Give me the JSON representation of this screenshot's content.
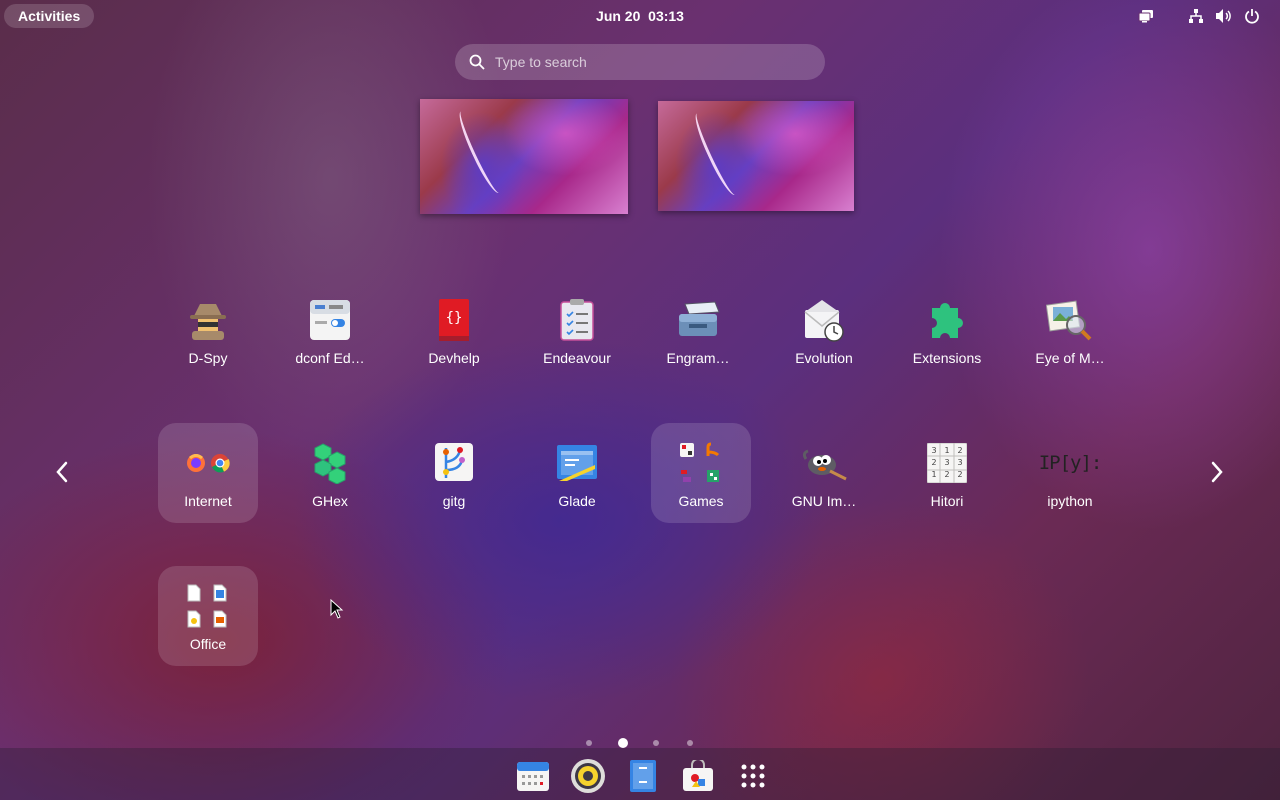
{
  "topbar": {
    "activities_label": "Activities",
    "clock": "Jun 20  03:13",
    "tray": [
      "display-icon",
      "network-icon",
      "volume-icon",
      "power-icon"
    ]
  },
  "search": {
    "placeholder": "Type to search"
  },
  "workspaces": 2,
  "apps_row1": [
    {
      "label": "D-Spy",
      "icon": "spy-icon"
    },
    {
      "label": "dconf Ed…",
      "icon": "dconf-icon"
    },
    {
      "label": "Devhelp",
      "icon": "devhelp-icon"
    },
    {
      "label": "Endeavour",
      "icon": "clipboard-icon"
    },
    {
      "label": "Engram…",
      "icon": "engrampa-icon"
    },
    {
      "label": "Evolution",
      "icon": "evolution-icon"
    },
    {
      "label": "Extensions",
      "icon": "puzzle-icon"
    },
    {
      "label": "Eye of M…",
      "icon": "image-viewer-icon"
    }
  ],
  "apps_row2": [
    {
      "label": "Internet",
      "icon": "internet-folder-icon",
      "folder": true
    },
    {
      "label": "GHex",
      "icon": "ghex-icon"
    },
    {
      "label": "gitg",
      "icon": "gitg-icon"
    },
    {
      "label": "Glade",
      "icon": "glade-icon"
    },
    {
      "label": "Games",
      "icon": "games-folder-icon",
      "folder": true
    },
    {
      "label": "GNU Im…",
      "icon": "gimp-icon"
    },
    {
      "label": "Hitori",
      "icon": "hitori-icon"
    },
    {
      "label": "ipython",
      "icon": "ipython-icon"
    }
  ],
  "apps_row3": [
    {
      "label": "Office",
      "icon": "office-folder-icon",
      "folder": true
    }
  ],
  "ipython_text": "IP[y]:",
  "pages": {
    "count": 4,
    "current": 2
  },
  "dash": [
    "calendar-icon",
    "rhythmbox-icon",
    "files-icon",
    "software-icon",
    "app-grid-icon"
  ]
}
